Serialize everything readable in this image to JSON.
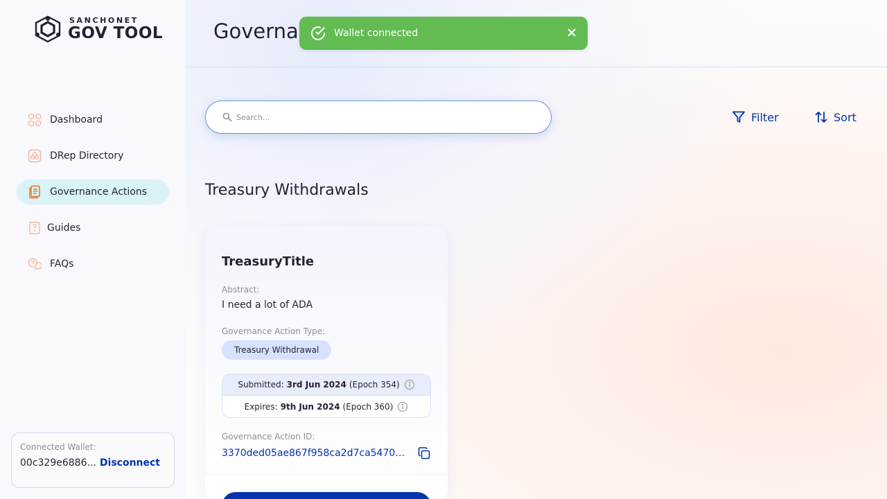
{
  "app": {
    "logo_small": "SANCHONET",
    "logo_big": "GOV TOOL"
  },
  "sidebar": {
    "items": [
      {
        "label": "Dashboard",
        "icon": "dashboard-icon"
      },
      {
        "label": "DRep Directory",
        "icon": "drep-directory-icon"
      },
      {
        "label": "Governance Actions",
        "icon": "governance-actions-icon",
        "active": true
      },
      {
        "label": "Guides",
        "icon": "guides-icon"
      },
      {
        "label": "FAQs",
        "icon": "faqs-icon"
      }
    ],
    "wallet": {
      "label": "Connected Wallet:",
      "address": "00c329e6886...",
      "disconnect": "Disconnect"
    }
  },
  "header": {
    "title": "Governance Actions"
  },
  "toast": {
    "message": "Wallet connected",
    "color": "#62bc52"
  },
  "search": {
    "placeholder": "Search...",
    "value": ""
  },
  "toolbar": {
    "filter_label": "Filter",
    "sort_label": "Sort"
  },
  "section": {
    "title": "Treasury Withdrawals"
  },
  "card": {
    "title": "TreasuryTitle",
    "abstract_label": "Abstract:",
    "abstract": "I need a lot of ADA",
    "type_label": "Governance Action Type:",
    "type": "Treasury Withdrawal",
    "submitted_label": "Submitted:",
    "submitted_date": "3rd Jun 2024",
    "submitted_epoch": "(Epoch 354)",
    "expires_label": "Expires:",
    "expires_date": "9th Jun 2024",
    "expires_epoch": "(Epoch 360)",
    "id_label": "Governance Action ID:",
    "id": "3370ded05ae867f958ca2d7ca5470e..."
  },
  "colors": {
    "primary": "#0033ad",
    "active_nav": "#d9f3f6",
    "pill": "#d6e2ff"
  }
}
